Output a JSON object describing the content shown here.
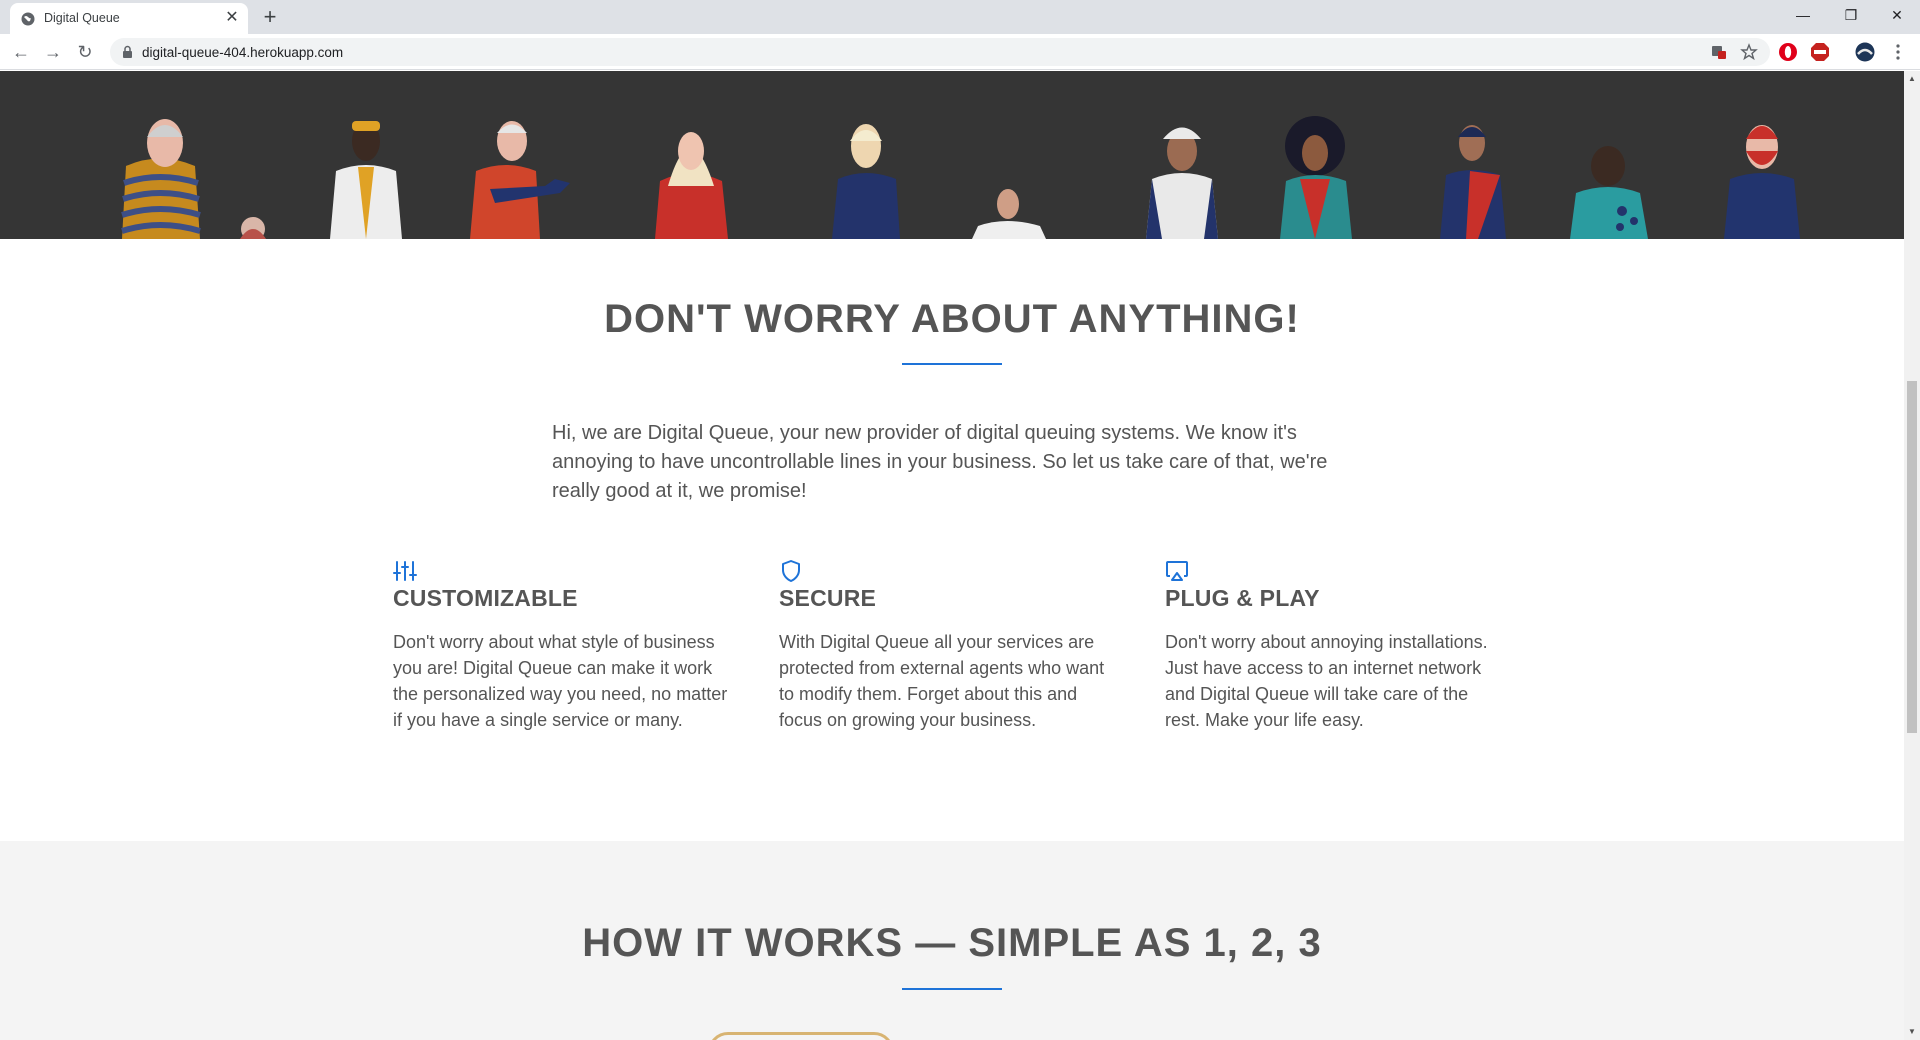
{
  "browser": {
    "tab_title": "Digital Queue",
    "url": "digital-queue-404.herokuapp.com",
    "tab_close_glyph": "✕",
    "new_tab_glyph": "+",
    "nav": {
      "back_glyph": "←",
      "forward_glyph": "→",
      "reload_glyph": "↻"
    },
    "window": {
      "minimize_glyph": "—",
      "restore_glyph": "❐",
      "close_glyph": "✕"
    },
    "extensions": [
      "translate-icon",
      "bookmark-star-icon",
      "opera-icon",
      "adblock-icon",
      "profile-avatar-icon",
      "menu-dots-icon"
    ]
  },
  "hero": {
    "background_color": "#353535",
    "illustration": "diverse-people-illustration"
  },
  "features_section": {
    "title": "DON'T WORRY ABOUT ANYTHING!",
    "intro": "Hi, we are Digital Queue, your new provider of digital queuing systems. We know it's annoying to have uncontrollable lines in your business. So let us take care of that, we're really good at it, we promise!",
    "items": [
      {
        "icon": "sliders-icon",
        "title": "CUSTOMIZABLE",
        "text": "Don't worry about what style of business you are! Digital Queue can make it work the personalized way you need, no matter if you have a single service or many."
      },
      {
        "icon": "shield-icon",
        "title": "SECURE",
        "text": "With Digital Queue all your services are protected from external agents who want to modify them. Forget about this and focus on growing your business."
      },
      {
        "icon": "airplay-icon",
        "title": "PLUG & PLAY",
        "text": "Don't worry about annoying installations. Just have access to an internet network and Digital Queue will take care of the rest. Make your life easy."
      }
    ]
  },
  "how_section": {
    "title": "HOW IT WORKS — SIMPLE AS 1, 2, 3"
  },
  "colors": {
    "accent": "#1e73d8",
    "text": "#555555",
    "hero_bg": "#353535",
    "how_bg": "#f4f4f4",
    "badge_border": "#d8b472"
  }
}
